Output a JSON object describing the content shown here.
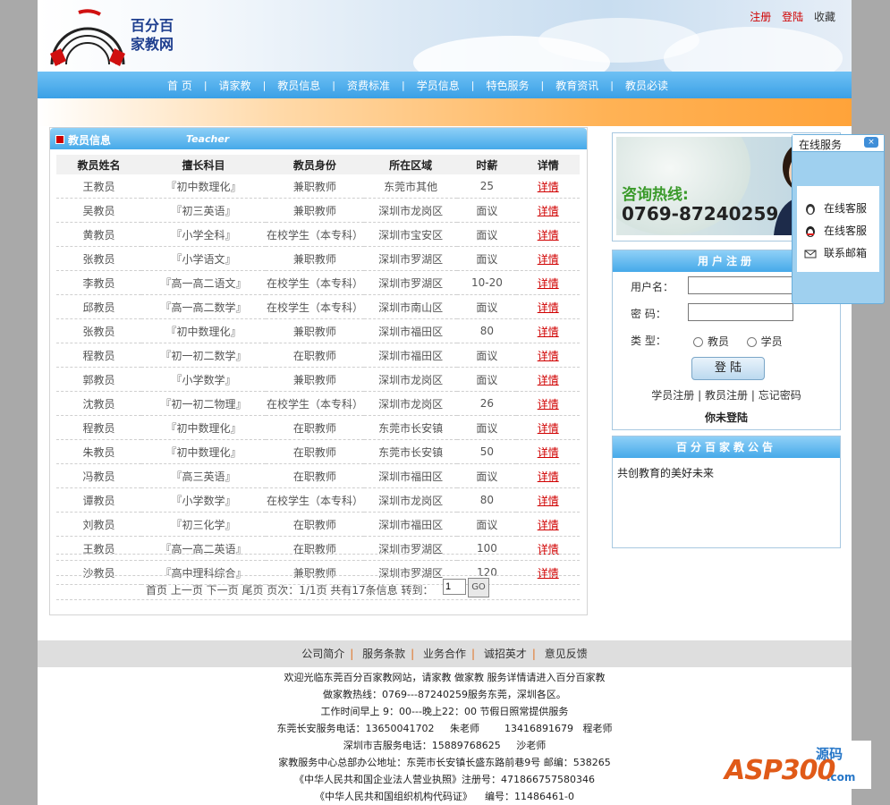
{
  "header": {
    "logo_line1": "百分百",
    "logo_line2": "家教网",
    "links": {
      "register": "注册",
      "login": "登陆",
      "favorite": "收藏"
    }
  },
  "nav": {
    "items": [
      "首 页",
      "请家教",
      "教员信息",
      "资费标准",
      "学员信息",
      "特色服务",
      "教育资讯",
      "教员必读"
    ],
    "separator": "|"
  },
  "teacher_panel": {
    "title": "教员信息",
    "subtitle": "Teacher",
    "columns": [
      "教员姓名",
      "擅长科目",
      "教员身份",
      "所在区域",
      "时薪",
      "详情"
    ],
    "rows": [
      [
        "王教员",
        "『初中数理化』",
        "兼职教师",
        "东莞市其他",
        "25",
        "详情"
      ],
      [
        "吴教员",
        "『初三英语』",
        "兼职教师",
        "深圳市龙岗区",
        "面议",
        "详情"
      ],
      [
        "黄教员",
        "『小学全科』",
        "在校学生（本专科）",
        "深圳市宝安区",
        "面议",
        "详情"
      ],
      [
        "张教员",
        "『小学语文』",
        "兼职教师",
        "深圳市罗湖区",
        "面议",
        "详情"
      ],
      [
        "李教员",
        "『高一高二语文』",
        "在校学生（本专科）",
        "深圳市罗湖区",
        "10-20",
        "详情"
      ],
      [
        "邱教员",
        "『高一高二数学』",
        "在校学生（本专科）",
        "深圳市南山区",
        "面议",
        "详情"
      ],
      [
        "张教员",
        "『初中数理化』",
        "兼职教师",
        "深圳市福田区",
        "80",
        "详情"
      ],
      [
        "程教员",
        "『初一初二数学』",
        "在职教师",
        "深圳市福田区",
        "面议",
        "详情"
      ],
      [
        "郭教员",
        "『小学数学』",
        "兼职教师",
        "深圳市龙岗区",
        "面议",
        "详情"
      ],
      [
        "沈教员",
        "『初一初二物理』",
        "在校学生（本专科）",
        "深圳市龙岗区",
        "26",
        "详情"
      ],
      [
        "程教员",
        "『初中数理化』",
        "在职教师",
        "东莞市长安镇",
        "面议",
        "详情"
      ],
      [
        "朱教员",
        "『初中数理化』",
        "在职教师",
        "东莞市长安镇",
        "50",
        "详情"
      ],
      [
        "冯教员",
        "『高三英语』",
        "在职教师",
        "深圳市福田区",
        "面议",
        "详情"
      ],
      [
        "谭教员",
        "『小学数学』",
        "在校学生（本专科）",
        "深圳市龙岗区",
        "80",
        "详情"
      ],
      [
        "刘教员",
        "『初三化学』",
        "在职教师",
        "深圳市福田区",
        "面议",
        "详情"
      ],
      [
        "王教员",
        "『高一高二英语』",
        "在职教师",
        "深圳市罗湖区",
        "100",
        "详情"
      ],
      [
        "沙教员",
        "『高中理科综合』",
        "兼职教师",
        "深圳市罗湖区",
        "120",
        "详情"
      ]
    ],
    "pager": {
      "text": "首页  上一页  下一页  尾页  页次：1/1页  共有17条信息  转到：",
      "page_value": "1",
      "go_label": "GO"
    }
  },
  "hotline": {
    "label": "咨询热线:",
    "number": "0769-87240259"
  },
  "register_box": {
    "title": "用户注册",
    "username_label": "用户名：",
    "password_label": "密  码：",
    "type_label": "类  型：",
    "type_options": [
      "教员",
      "学员"
    ],
    "login_button": "登 陆",
    "links": [
      "学员注册",
      "教员注册",
      "忘记密码"
    ],
    "status": "你未登陆"
  },
  "notice_box": {
    "title": "百分百家教公告",
    "text": "共创教育的美好未来"
  },
  "online_service": {
    "title": "在线服务",
    "close": "×",
    "items": [
      "在线客服",
      "在线客服",
      "联系邮箱"
    ]
  },
  "footer": {
    "links": [
      "公司简介",
      "服务条款",
      "业务合作",
      "诚招英才",
      "意见反馈"
    ],
    "lines": [
      "欢迎光临东莞百分百家教网站，请家教 做家教 服务详情请进入百分百家教",
      "做家教热线：0769---87240259服务东莞，深圳各区。",
      "工作时间早上 9：00---晚上22：00 节假日照常提供服务",
      "东莞长安服务电话：13650041702     朱老师        13416891679   程老师",
      "深圳市吉服务电话：15889768625     沙老师",
      "家教服务中心总部办公地址：东莞市长安镇长盛东路前巷9号 邮编：538265",
      "《中华人民共和国企业法人营业执照》注册号：471866757580346",
      "《中华人民共和国组织机构代码证》    编号：11486461-0"
    ]
  },
  "watermark": {
    "brand": "ASP300",
    "tag": "源码",
    "domain": ".com"
  },
  "colors": {
    "nav_blue": "#3aa0e6",
    "link_red": "#d00000",
    "orange_bar": "#ffa33a"
  }
}
